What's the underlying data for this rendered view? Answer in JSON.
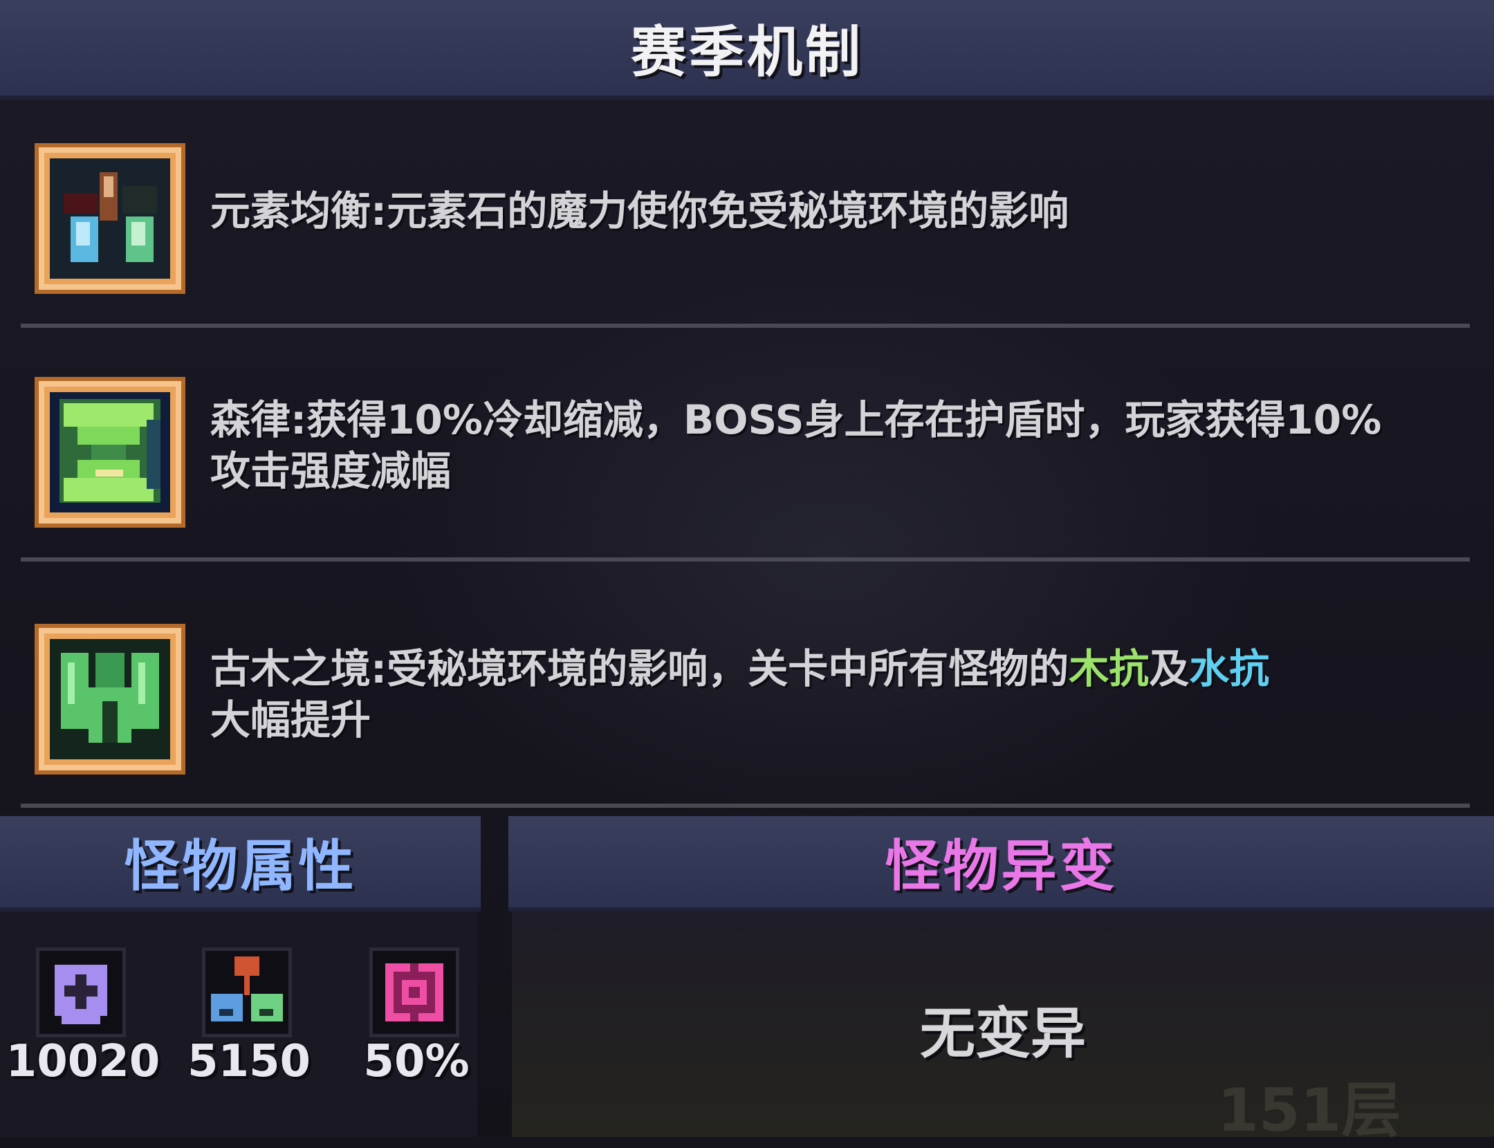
{
  "header": {
    "title": "赛季机制"
  },
  "mechanics": [
    {
      "icon": "elemental-gems-icon",
      "name": "元素均衡",
      "text": "元素均衡:元素石的魔力使你免受秘境环境的影响"
    },
    {
      "icon": "hourglass-icon",
      "name": "森律",
      "line1": "森律:获得10%冷却缩减，BOSS身上存在护盾时，玩家获得10%",
      "line2": "攻击强度减幅"
    },
    {
      "icon": "ancient-wood-icon",
      "name": "古木之境",
      "prefix": "古木之境:受秘境环境的影响，关卡中所有怪物的",
      "wood": "木抗",
      "and": "及",
      "water": "水抗",
      "line2": "大幅提升"
    }
  ],
  "monster_attributes": {
    "title": "怪物属性",
    "stats": [
      {
        "icon": "health-shield-icon",
        "value": "10020"
      },
      {
        "icon": "attack-nodes-icon",
        "value": "5150"
      },
      {
        "icon": "pink-gear-icon",
        "value": "50%"
      }
    ]
  },
  "monster_mutation": {
    "title": "怪物异变",
    "value": "无变异"
  },
  "floor_label": "151层",
  "colors": {
    "header_bg": "#3a3f5e",
    "wood_resist": "#9be36a",
    "water_resist": "#5fd0f2",
    "attr_title": "#8fb6ff",
    "mutation_title": "#e977e8"
  }
}
